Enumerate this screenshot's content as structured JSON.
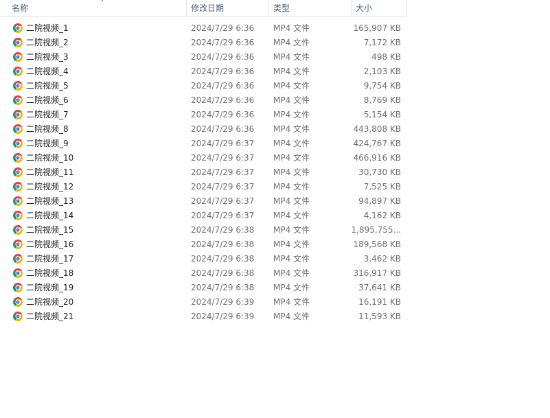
{
  "columns": {
    "name": "名称",
    "date": "修改日期",
    "type": "类型",
    "size": "大小"
  },
  "icons": {
    "file_icon": "chrome-icon",
    "sort_icon": "sort-caret-icon"
  },
  "colors": {
    "header_text": "#4c607a",
    "meta_text": "#6d6d6d",
    "name_text": "#1a1a1a",
    "chrome_red": "#db4437",
    "chrome_green": "#0f9d58",
    "chrome_yellow": "#f4b400",
    "chrome_blue": "#4285f4"
  },
  "files": [
    {
      "name": "二院视频_1",
      "date": "2024/7/29 6:36",
      "type": "MP4 文件",
      "size": "165,907 KB"
    },
    {
      "name": "二院视频_2",
      "date": "2024/7/29 6:36",
      "type": "MP4 文件",
      "size": "7,172 KB"
    },
    {
      "name": "二院视频_3",
      "date": "2024/7/29 6:36",
      "type": "MP4 文件",
      "size": "498 KB"
    },
    {
      "name": "二院视频_4",
      "date": "2024/7/29 6:36",
      "type": "MP4 文件",
      "size": "2,103 KB"
    },
    {
      "name": "二院视频_5",
      "date": "2024/7/29 6:36",
      "type": "MP4 文件",
      "size": "9,754 KB"
    },
    {
      "name": "二院视频_6",
      "date": "2024/7/29 6:36",
      "type": "MP4 文件",
      "size": "8,769 KB"
    },
    {
      "name": "二院视频_7",
      "date": "2024/7/29 6:36",
      "type": "MP4 文件",
      "size": "5,154 KB"
    },
    {
      "name": "二院视频_8",
      "date": "2024/7/29 6:36",
      "type": "MP4 文件",
      "size": "443,808 KB"
    },
    {
      "name": "二院视频_9",
      "date": "2024/7/29 6:37",
      "type": "MP4 文件",
      "size": "424,767 KB"
    },
    {
      "name": "二院视频_10",
      "date": "2024/7/29 6:37",
      "type": "MP4 文件",
      "size": "466,916 KB"
    },
    {
      "name": "二院视频_11",
      "date": "2024/7/29 6:37",
      "type": "MP4 文件",
      "size": "30,730 KB"
    },
    {
      "name": "二院视频_12",
      "date": "2024/7/29 6:37",
      "type": "MP4 文件",
      "size": "7,525 KB"
    },
    {
      "name": "二院视频_13",
      "date": "2024/7/29 6:37",
      "type": "MP4 文件",
      "size": "94,897 KB"
    },
    {
      "name": "二院视频_14",
      "date": "2024/7/29 6:37",
      "type": "MP4 文件",
      "size": "4,162 KB"
    },
    {
      "name": "二院视频_15",
      "date": "2024/7/29 6:38",
      "type": "MP4 文件",
      "size": "1,895,755..."
    },
    {
      "name": "二院视频_16",
      "date": "2024/7/29 6:38",
      "type": "MP4 文件",
      "size": "189,568 KB"
    },
    {
      "name": "二院视频_17",
      "date": "2024/7/29 6:38",
      "type": "MP4 文件",
      "size": "3,462 KB"
    },
    {
      "name": "二院视频_18",
      "date": "2024/7/29 6:38",
      "type": "MP4 文件",
      "size": "316,917 KB"
    },
    {
      "name": "二院视频_19",
      "date": "2024/7/29 6:38",
      "type": "MP4 文件",
      "size": "37,641 KB"
    },
    {
      "name": "二院视频_20",
      "date": "2024/7/29 6:39",
      "type": "MP4 文件",
      "size": "16,191 KB"
    },
    {
      "name": "二院视频_21",
      "date": "2024/7/29 6:39",
      "type": "MP4 文件",
      "size": "11,593 KB"
    }
  ]
}
